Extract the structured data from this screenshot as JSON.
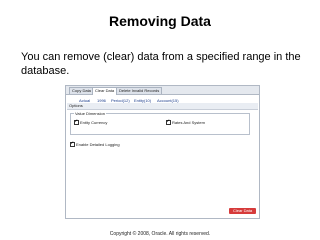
{
  "slide": {
    "title": "Removing Data",
    "body": "You can remove (clear) data from a specified range in the database.",
    "copyright": "Copyright © 2008, Oracle. All rights reserved."
  },
  "screenshot": {
    "tabs": [
      {
        "label": "Copy Data",
        "active": false
      },
      {
        "label": "Clear Data",
        "active": true
      },
      {
        "label": "Delete Invalid Records",
        "active": false
      }
    ],
    "subnav": [
      {
        "label": "Actual"
      },
      {
        "label": "1996"
      },
      {
        "label": "Period(12)"
      },
      {
        "label": "Entity(10)"
      },
      {
        "label": "Account(15)"
      }
    ],
    "options_label": "Options",
    "value_dimension": {
      "legend": "Value Dimension",
      "checkboxes": [
        {
          "label": "Entity Currency",
          "checked": true
        },
        {
          "label": "Rates And System",
          "checked": true
        }
      ]
    },
    "detailed_logging": {
      "label": "Enable Detailed Logging",
      "checked": true
    },
    "clear_button": "Clear Data",
    "check_mark": "✔",
    "colors": {
      "button_bg": "#d63b3b",
      "tab_bar": "#e4e8ee",
      "link": "#1a3c8c"
    }
  }
}
